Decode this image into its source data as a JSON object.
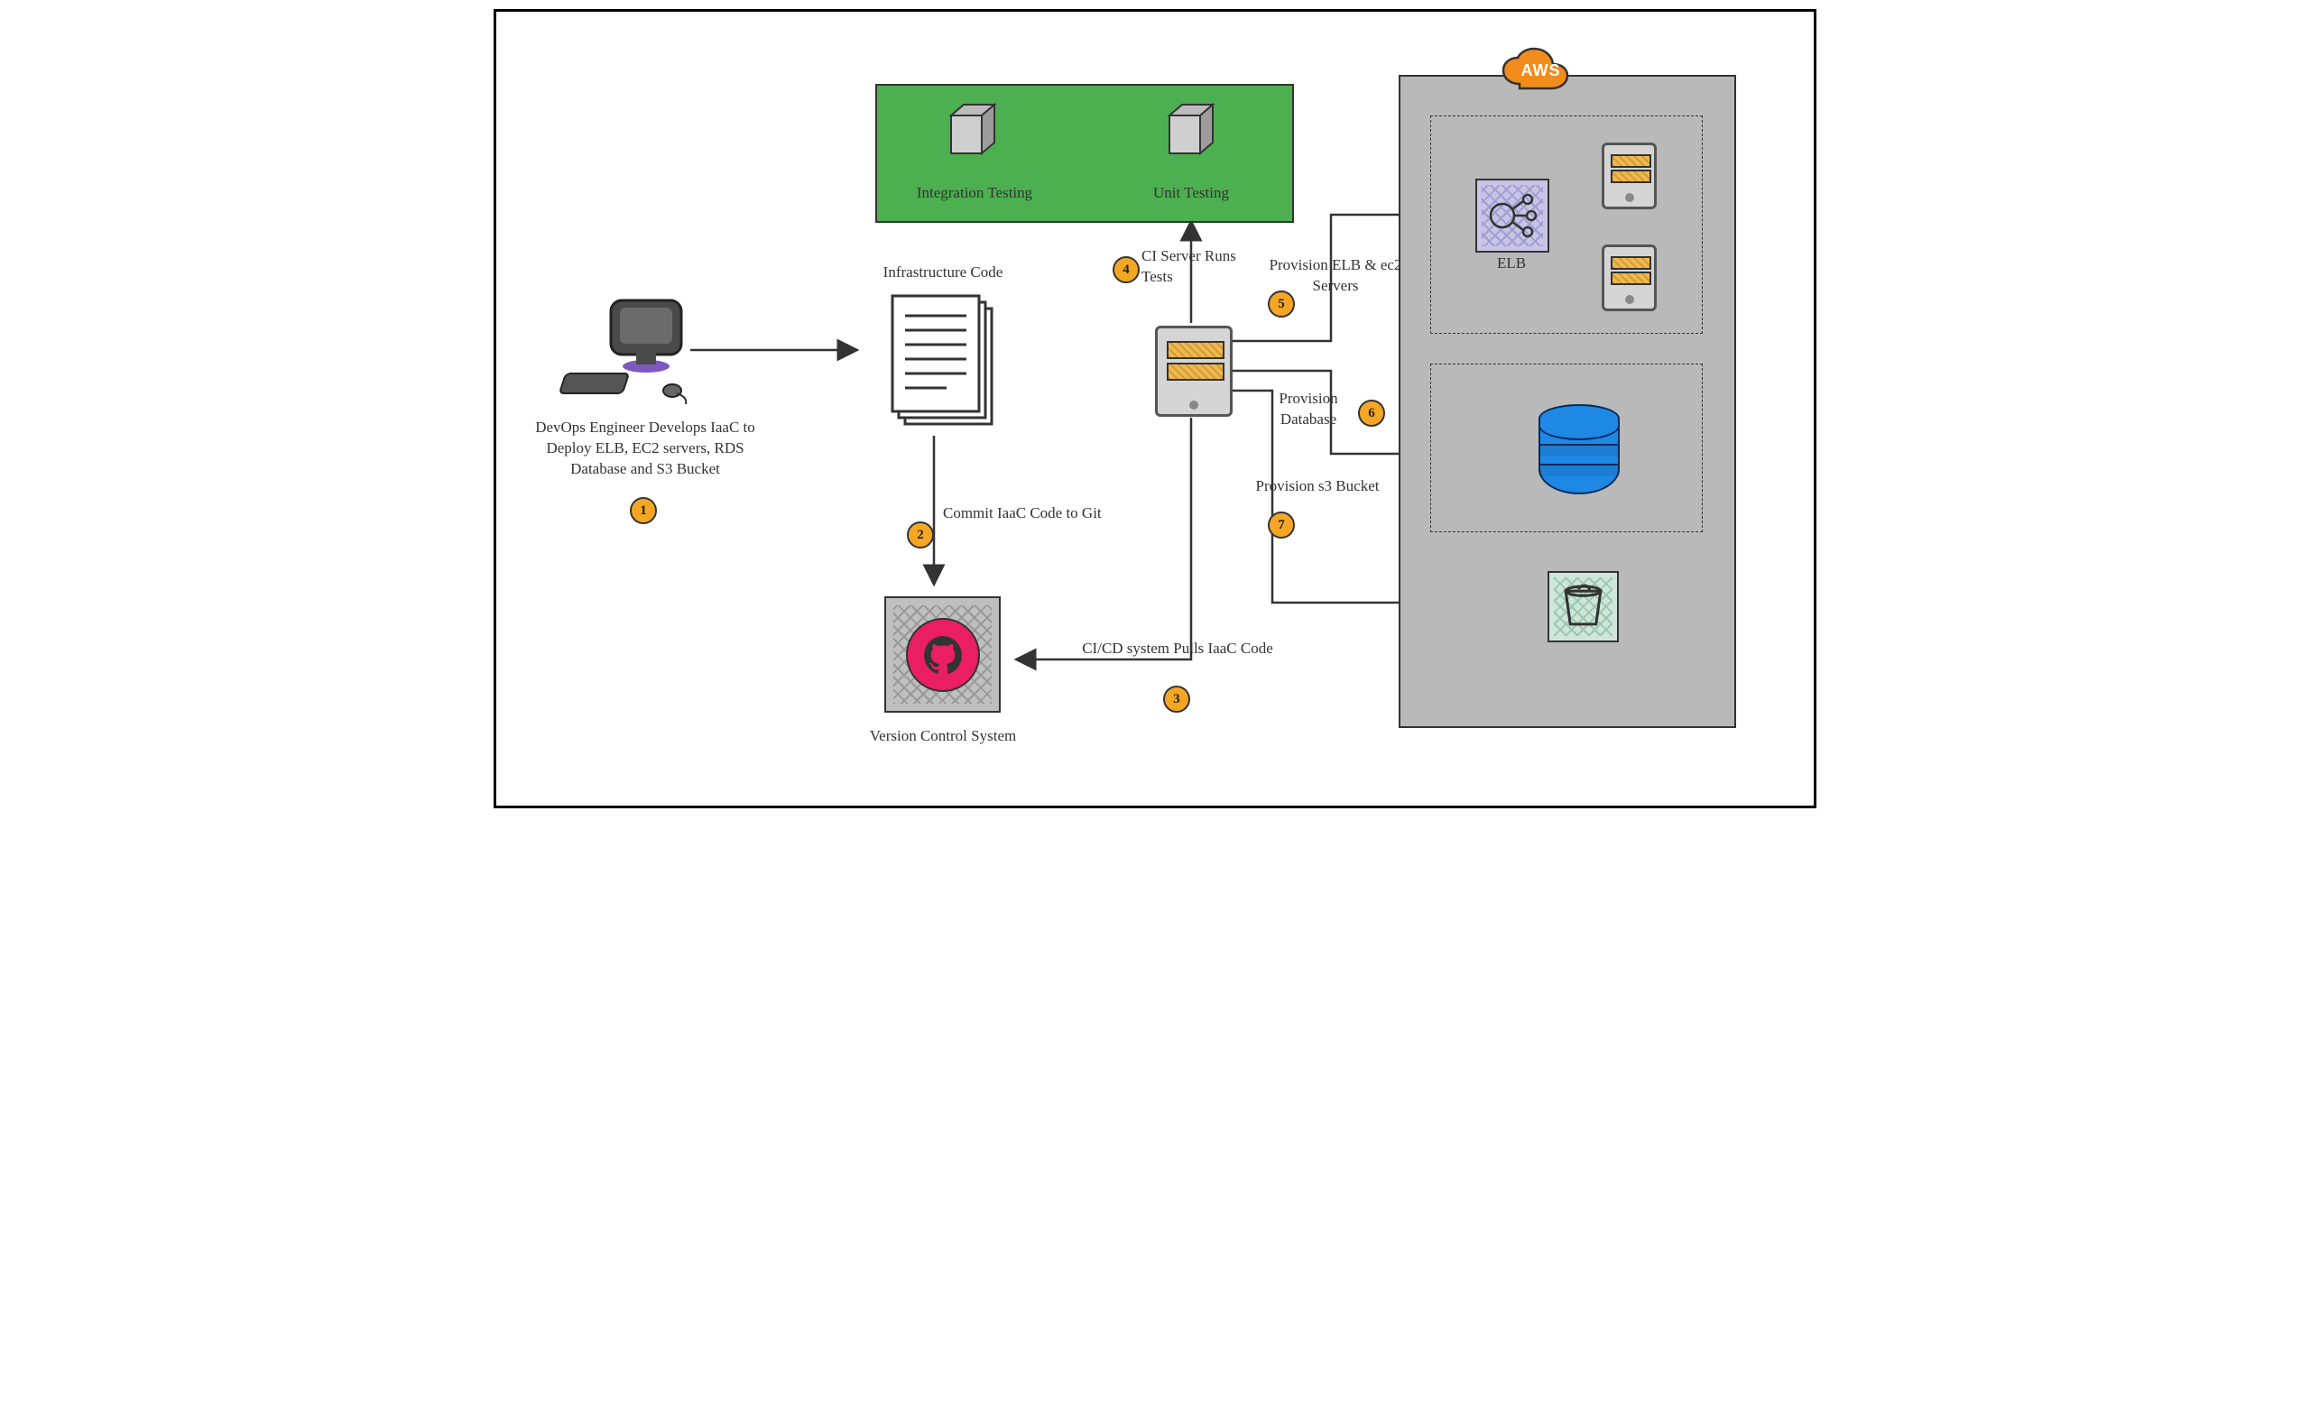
{
  "steps": {
    "1": {
      "text": "DevOps Engineer Develops IaaC to Deploy ELB, EC2 servers, RDS Database and S3 Bucket"
    },
    "2": {
      "text": "Commit IaaC Code to Git"
    },
    "3": {
      "text": "CI/CD system Pulls IaaC Code"
    },
    "4": {
      "text": "CI Server Runs Tests"
    },
    "5": {
      "text": "Provision ELB & ec2 Servers"
    },
    "6": {
      "text": "Provision Database"
    },
    "7": {
      "text": "Provision s3 Bucket"
    }
  },
  "labels": {
    "infra_code": "Infrastructure Code",
    "vcs": "Version Control System",
    "integration_testing": "Integration Testing",
    "unit_testing": "Unit Testing",
    "elb": "ELB",
    "aws": "AWS"
  },
  "flows": [
    {
      "from": "devops-workstation",
      "to": "infrastructure-code",
      "via": "1"
    },
    {
      "from": "infrastructure-code",
      "to": "git-vcs",
      "via": "2"
    },
    {
      "from": "git-vcs",
      "to": "ci-cd-server",
      "via": "3"
    },
    {
      "from": "ci-cd-server",
      "to": "testing-box",
      "via": "4"
    },
    {
      "from": "unit-testing",
      "to": "integration-testing"
    },
    {
      "from": "ci-cd-server",
      "to": "aws-elb",
      "via": "5"
    },
    {
      "from": "aws-elb",
      "to": "ec2-server-1"
    },
    {
      "from": "aws-elb",
      "to": "ec2-server-2"
    },
    {
      "from": "ci-cd-server",
      "to": "aws-rds",
      "via": "6"
    },
    {
      "from": "ci-cd-server",
      "to": "aws-s3",
      "via": "7"
    }
  ]
}
